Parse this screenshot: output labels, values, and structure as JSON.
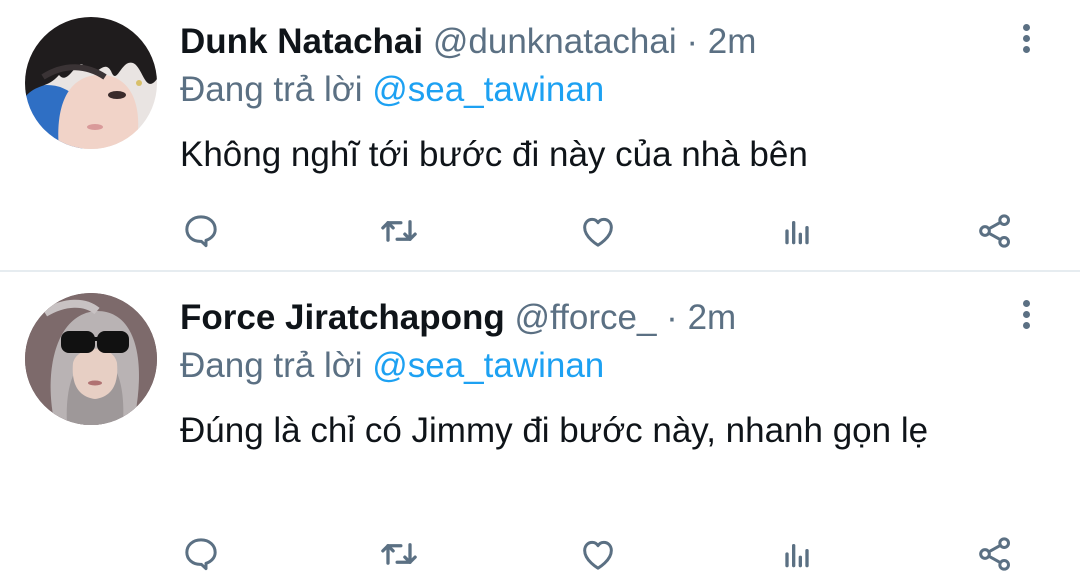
{
  "colors": {
    "text": "#0f1419",
    "secondary": "#5b7083",
    "link": "#1da1f2",
    "divider": "#e6ecf0"
  },
  "tweets": [
    {
      "name": "Dunk Natachai",
      "handle": "@dunknatachai",
      "separator": "·",
      "time": "2m",
      "reply_prefix": "Đang trả lời",
      "reply_to": "@sea_tawinan",
      "text": "Không nghĩ tới bước đi này của nhà bên",
      "avatar_icon": "profile-photo-avatar",
      "menu_icon": "more-vertical-icon",
      "action_icons": [
        "reply-icon",
        "retweet-icon",
        "like-icon",
        "views-icon",
        "share-icon"
      ]
    },
    {
      "name": "Force Jiratchapong",
      "handle": "@fforce_",
      "separator": "·",
      "time": "2m",
      "reply_prefix": "Đang trả lời",
      "reply_to": "@sea_tawinan",
      "text": "Đúng là chỉ có Jimmy đi bước này, nhanh gọn lẹ",
      "avatar_icon": "profile-photo-avatar",
      "menu_icon": "more-vertical-icon",
      "action_icons": [
        "reply-icon",
        "retweet-icon",
        "like-icon",
        "views-icon",
        "share-icon"
      ]
    }
  ]
}
